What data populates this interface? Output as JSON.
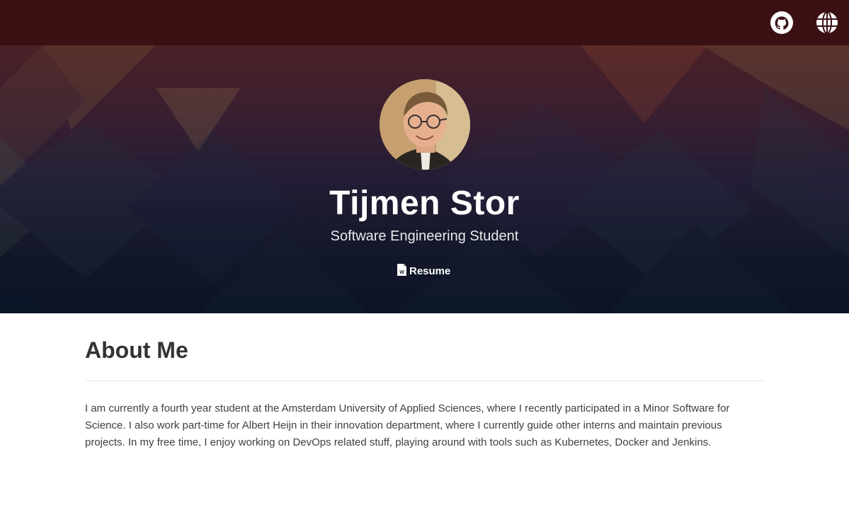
{
  "nav": {
    "icons": [
      {
        "name": "github-icon",
        "label": "GitHub"
      },
      {
        "name": "globe-icon",
        "label": "Website"
      }
    ]
  },
  "hero": {
    "title": "Tijmen Stor",
    "subtitle": "Software Engineering Student",
    "resume_label": "Resume",
    "resume_icon": "word-document-icon"
  },
  "about": {
    "heading": "About Me",
    "paragraph": "I am currently a fourth year student at the Amsterdam University of Applied Sciences, where I recently participated in a Minor Software for Science. I also work part-time for Albert Heijn in their innovation department, where I currently guide other interns and maintain previous projects. In my free time, I enjoy working on DevOps related stuff, playing around with tools such as Kubernetes, Docker and Jenkins."
  },
  "colors": {
    "topbar": "#3b1012",
    "hero_top": "#4a2026",
    "hero_bottom": "#0b1424",
    "heading_text": "#333333",
    "body_text": "#404040"
  }
}
